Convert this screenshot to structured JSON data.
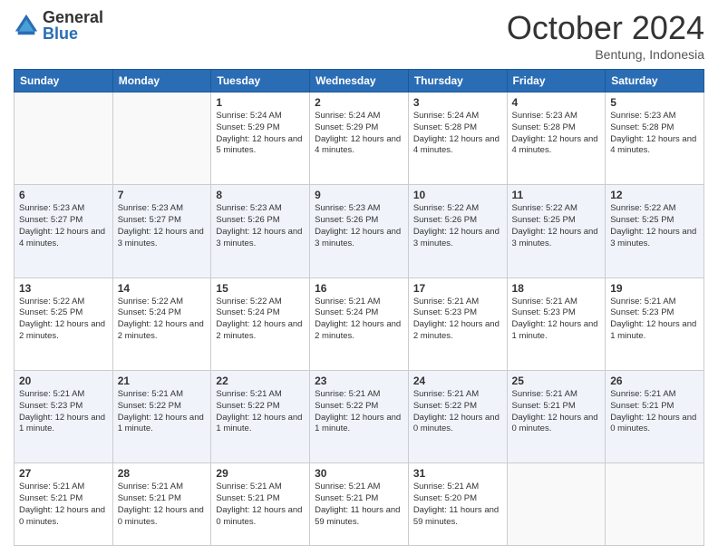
{
  "header": {
    "logo_general": "General",
    "logo_blue": "Blue",
    "month_title": "October 2024",
    "subtitle": "Bentung, Indonesia"
  },
  "days_of_week": [
    "Sunday",
    "Monday",
    "Tuesday",
    "Wednesday",
    "Thursday",
    "Friday",
    "Saturday"
  ],
  "weeks": [
    [
      {
        "day": "",
        "info": ""
      },
      {
        "day": "",
        "info": ""
      },
      {
        "day": "1",
        "info": "Sunrise: 5:24 AM\nSunset: 5:29 PM\nDaylight: 12 hours and 5 minutes."
      },
      {
        "day": "2",
        "info": "Sunrise: 5:24 AM\nSunset: 5:29 PM\nDaylight: 12 hours and 4 minutes."
      },
      {
        "day": "3",
        "info": "Sunrise: 5:24 AM\nSunset: 5:28 PM\nDaylight: 12 hours and 4 minutes."
      },
      {
        "day": "4",
        "info": "Sunrise: 5:23 AM\nSunset: 5:28 PM\nDaylight: 12 hours and 4 minutes."
      },
      {
        "day": "5",
        "info": "Sunrise: 5:23 AM\nSunset: 5:28 PM\nDaylight: 12 hours and 4 minutes."
      }
    ],
    [
      {
        "day": "6",
        "info": "Sunrise: 5:23 AM\nSunset: 5:27 PM\nDaylight: 12 hours and 4 minutes."
      },
      {
        "day": "7",
        "info": "Sunrise: 5:23 AM\nSunset: 5:27 PM\nDaylight: 12 hours and 3 minutes."
      },
      {
        "day": "8",
        "info": "Sunrise: 5:23 AM\nSunset: 5:26 PM\nDaylight: 12 hours and 3 minutes."
      },
      {
        "day": "9",
        "info": "Sunrise: 5:23 AM\nSunset: 5:26 PM\nDaylight: 12 hours and 3 minutes."
      },
      {
        "day": "10",
        "info": "Sunrise: 5:22 AM\nSunset: 5:26 PM\nDaylight: 12 hours and 3 minutes."
      },
      {
        "day": "11",
        "info": "Sunrise: 5:22 AM\nSunset: 5:25 PM\nDaylight: 12 hours and 3 minutes."
      },
      {
        "day": "12",
        "info": "Sunrise: 5:22 AM\nSunset: 5:25 PM\nDaylight: 12 hours and 3 minutes."
      }
    ],
    [
      {
        "day": "13",
        "info": "Sunrise: 5:22 AM\nSunset: 5:25 PM\nDaylight: 12 hours and 2 minutes."
      },
      {
        "day": "14",
        "info": "Sunrise: 5:22 AM\nSunset: 5:24 PM\nDaylight: 12 hours and 2 minutes."
      },
      {
        "day": "15",
        "info": "Sunrise: 5:22 AM\nSunset: 5:24 PM\nDaylight: 12 hours and 2 minutes."
      },
      {
        "day": "16",
        "info": "Sunrise: 5:21 AM\nSunset: 5:24 PM\nDaylight: 12 hours and 2 minutes."
      },
      {
        "day": "17",
        "info": "Sunrise: 5:21 AM\nSunset: 5:23 PM\nDaylight: 12 hours and 2 minutes."
      },
      {
        "day": "18",
        "info": "Sunrise: 5:21 AM\nSunset: 5:23 PM\nDaylight: 12 hours and 1 minute."
      },
      {
        "day": "19",
        "info": "Sunrise: 5:21 AM\nSunset: 5:23 PM\nDaylight: 12 hours and 1 minute."
      }
    ],
    [
      {
        "day": "20",
        "info": "Sunrise: 5:21 AM\nSunset: 5:23 PM\nDaylight: 12 hours and 1 minute."
      },
      {
        "day": "21",
        "info": "Sunrise: 5:21 AM\nSunset: 5:22 PM\nDaylight: 12 hours and 1 minute."
      },
      {
        "day": "22",
        "info": "Sunrise: 5:21 AM\nSunset: 5:22 PM\nDaylight: 12 hours and 1 minute."
      },
      {
        "day": "23",
        "info": "Sunrise: 5:21 AM\nSunset: 5:22 PM\nDaylight: 12 hours and 1 minute."
      },
      {
        "day": "24",
        "info": "Sunrise: 5:21 AM\nSunset: 5:22 PM\nDaylight: 12 hours and 0 minutes."
      },
      {
        "day": "25",
        "info": "Sunrise: 5:21 AM\nSunset: 5:21 PM\nDaylight: 12 hours and 0 minutes."
      },
      {
        "day": "26",
        "info": "Sunrise: 5:21 AM\nSunset: 5:21 PM\nDaylight: 12 hours and 0 minutes."
      }
    ],
    [
      {
        "day": "27",
        "info": "Sunrise: 5:21 AM\nSunset: 5:21 PM\nDaylight: 12 hours and 0 minutes."
      },
      {
        "day": "28",
        "info": "Sunrise: 5:21 AM\nSunset: 5:21 PM\nDaylight: 12 hours and 0 minutes."
      },
      {
        "day": "29",
        "info": "Sunrise: 5:21 AM\nSunset: 5:21 PM\nDaylight: 12 hours and 0 minutes."
      },
      {
        "day": "30",
        "info": "Sunrise: 5:21 AM\nSunset: 5:21 PM\nDaylight: 11 hours and 59 minutes."
      },
      {
        "day": "31",
        "info": "Sunrise: 5:21 AM\nSunset: 5:20 PM\nDaylight: 11 hours and 59 minutes."
      },
      {
        "day": "",
        "info": ""
      },
      {
        "day": "",
        "info": ""
      }
    ]
  ]
}
